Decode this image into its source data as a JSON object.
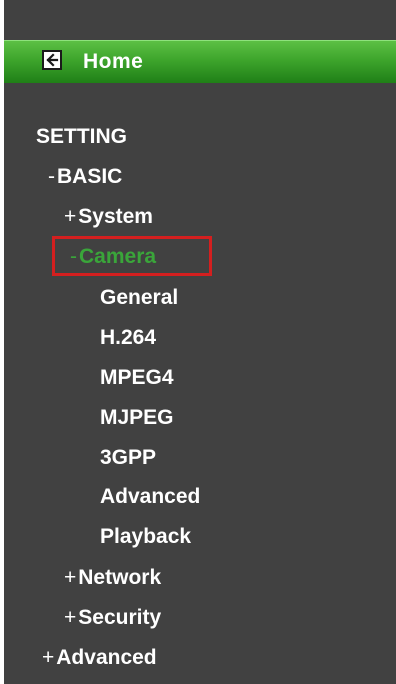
{
  "home": {
    "label": "Home",
    "icon": "back-arrow-icon"
  },
  "tree": {
    "heading": "SETTING",
    "basic": {
      "prefix": "-",
      "label": "BASIC"
    },
    "system": {
      "prefix": "+",
      "label": "System"
    },
    "camera": {
      "prefix": "-",
      "label": "Camera"
    },
    "camera_items": [
      {
        "label": "General"
      },
      {
        "label": "H.264"
      },
      {
        "label": "MPEG4"
      },
      {
        "label": "MJPEG"
      },
      {
        "label": "3GPP"
      },
      {
        "label": "Advanced"
      },
      {
        "label": "Playback"
      }
    ],
    "network": {
      "prefix": "+",
      "label": "Network"
    },
    "security": {
      "prefix": "+",
      "label": "Security"
    },
    "advanced": {
      "prefix": "+",
      "label": "Advanced"
    }
  },
  "colors": {
    "panel_bg": "#414141",
    "home_bar": "#3ea52c",
    "active_text": "#3aa53a",
    "highlight_border": "#d41f1f",
    "text": "#ffffff"
  }
}
